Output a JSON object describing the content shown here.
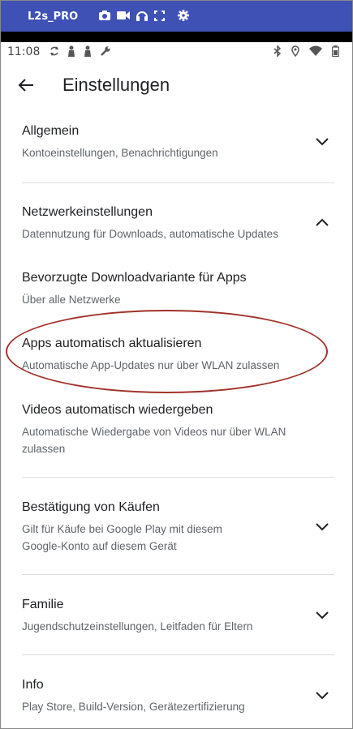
{
  "topbar": {
    "device": "L2s_PRO"
  },
  "status": {
    "time": "11:08"
  },
  "appbar": {
    "title": "Einstellungen"
  },
  "items": [
    {
      "title": "Allgemein",
      "subtitle": "Kontoeinstellungen, Benachrichtigungen"
    },
    {
      "title": "Netzwerkeinstellungen",
      "subtitle": "Datennutzung für Downloads, automatische Updates"
    },
    {
      "title": "Bevorzugte Downloadvariante für Apps",
      "subtitle": "Über alle Netzwerke"
    },
    {
      "title": "Apps automatisch aktualisieren",
      "subtitle": "Automatische App-Updates nur über WLAN zulassen"
    },
    {
      "title": "Videos automatisch wiedergeben",
      "subtitle_line1": "Automatische Wiedergabe von Videos nur über WLAN",
      "subtitle_line2": "zulassen"
    },
    {
      "title": "Bestätigung von Käufen",
      "subtitle_line1": "Gilt für Käufe bei Google Play mit diesem",
      "subtitle_line2": "Google-Konto auf diesem Gerät"
    },
    {
      "title": "Familie",
      "subtitle": "Jugendschutzeinstellungen, Leitfaden für Eltern"
    },
    {
      "title": "Info",
      "subtitle": "Play Store, Build-Version, Gerätezertifizierung"
    }
  ]
}
